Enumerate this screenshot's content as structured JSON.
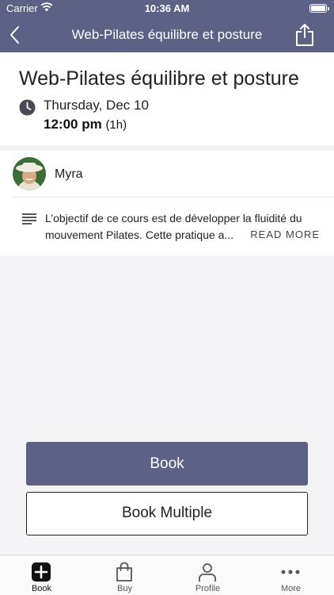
{
  "status_bar": {
    "carrier": "Carrier",
    "time": "10:36 AM"
  },
  "nav": {
    "title": "Web-Pilates équilibre et posture"
  },
  "class": {
    "title": "Web-Pilates équilibre et posture",
    "date": "Thursday, Dec 10",
    "time": "12:00 pm",
    "duration": "(1h)"
  },
  "instructor": {
    "name": "Myra"
  },
  "description": {
    "text": "L’objectif de ce cours est de développer la fluidité du mouvement Pilates. Cette pratique a...",
    "read_more": "READ MORE"
  },
  "actions": {
    "book": "Book",
    "book_multiple": "Book Multiple"
  },
  "tabs": [
    {
      "label": "Book",
      "icon": "plus-square-icon",
      "active": true
    },
    {
      "label": "Buy",
      "icon": "shopping-bag-icon",
      "active": false
    },
    {
      "label": "Profile",
      "icon": "person-icon",
      "active": false
    },
    {
      "label": "More",
      "icon": "ellipsis-icon",
      "active": false
    }
  ],
  "colors": {
    "brand": "#5c6185",
    "background": "#f4f4f7"
  }
}
